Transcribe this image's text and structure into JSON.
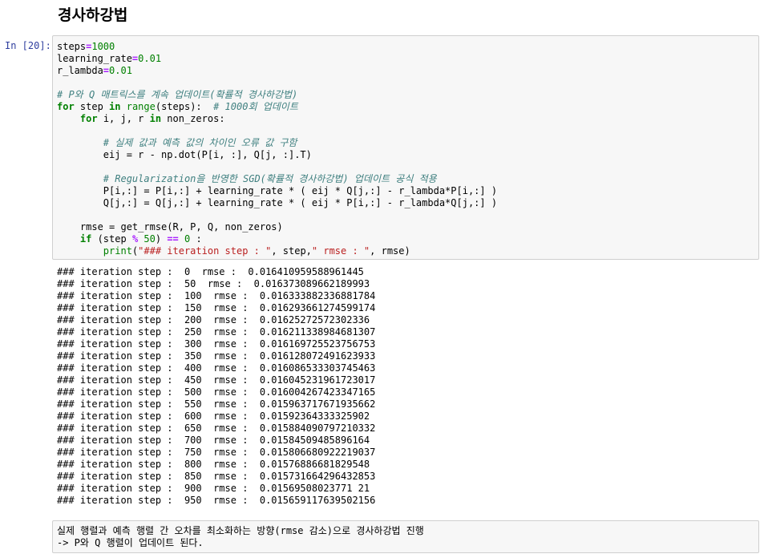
{
  "heading": "경사하강법",
  "prompt": "In [20]:",
  "code": {
    "l1": {
      "a": "steps",
      "b": "=",
      "c": "1000"
    },
    "l2": {
      "a": "learning_rate",
      "b": "=",
      "c": "0.01"
    },
    "l3": {
      "a": "r_lambda",
      "b": "=",
      "c": "0.01"
    },
    "c1": "# P와 Q 매트릭스를 계속 업데이트(확률적 경사하강법)",
    "l5": {
      "kw_for": "for",
      "var": " step ",
      "kw_in": "in",
      "sp": " ",
      "range": "range",
      "rest": "(steps):  ",
      "cm": "# 1000회 업데이트"
    },
    "l6": {
      "indent": "    ",
      "kw_for": "for",
      "var": " i, j, r ",
      "kw_in": "in",
      "rest": " non_zeros:"
    },
    "c2": "# 실제 값과 예측 값의 차이인 오류 값 구함",
    "l8": "        eij = r - np.dot(P[i, :], Q[j, :].T)",
    "c3": "# Regularization을 반영한 SGD(확률적 경사하강법) 업데이트 공식 적용",
    "l10": "        P[i,:] = P[i,:] + learning_rate * ( eij * Q[j,:] - r_lambda*P[i,:] )",
    "l11": "        Q[j,:] = Q[j,:] + learning_rate * ( eij * P[i,:] - r_lambda*Q[j,:] )",
    "l13": "    rmse = get_rmse(R, P, Q, non_zeros)",
    "l14": {
      "kw_if": "if",
      "pre": " (step ",
      "op": "%",
      "sp": " ",
      "n1": "50",
      "mid": ") ",
      "eq": "==",
      "sp2": " ",
      "n2": "0",
      "end": " :"
    },
    "l15": {
      "print": "print",
      "open": "(",
      "s1": "\"### iteration step : \"",
      "mid": ", step,",
      "s2": "\" rmse : \"",
      "end": ", rmse)"
    }
  },
  "output_lines": [
    "### iteration step :  0  rmse :  0.016410959588961445",
    "### iteration step :  50  rmse :  0.016373089662189993",
    "### iteration step :  100  rmse :  0.016333882336881784",
    "### iteration step :  150  rmse :  0.016293661274599174",
    "### iteration step :  200  rmse :  0.01625272572302336",
    "### iteration step :  250  rmse :  0.016211338984681307",
    "### iteration step :  300  rmse :  0.016169725523756753",
    "### iteration step :  350  rmse :  0.016128072491623933",
    "### iteration step :  400  rmse :  0.016086533303745463",
    "### iteration step :  450  rmse :  0.016045231961723017",
    "### iteration step :  500  rmse :  0.016004267423347165",
    "### iteration step :  550  rmse :  0.015963717671935662",
    "### iteration step :  600  rmse :  0.01592364333325902",
    "### iteration step :  650  rmse :  0.015884090797210332",
    "### iteration step :  700  rmse :  0.01584509485896164",
    "### iteration step :  750  rmse :  0.015806680922219037",
    "### iteration step :  800  rmse :  0.01576886681829548",
    "### iteration step :  850  rmse :  0.015731664296432853",
    "### iteration step :  900  rmse :  0.01569508023771 21",
    "### iteration step :  950  rmse :  0.015659117639502156"
  ],
  "markdown": {
    "line1": "실제 행렬과 예측 행렬 간 오차를 최소화하는 방향(rmse 감소)으로 경사하강법 진행",
    "line2": "-> P와 Q 행렬이 업데이트 된다."
  }
}
